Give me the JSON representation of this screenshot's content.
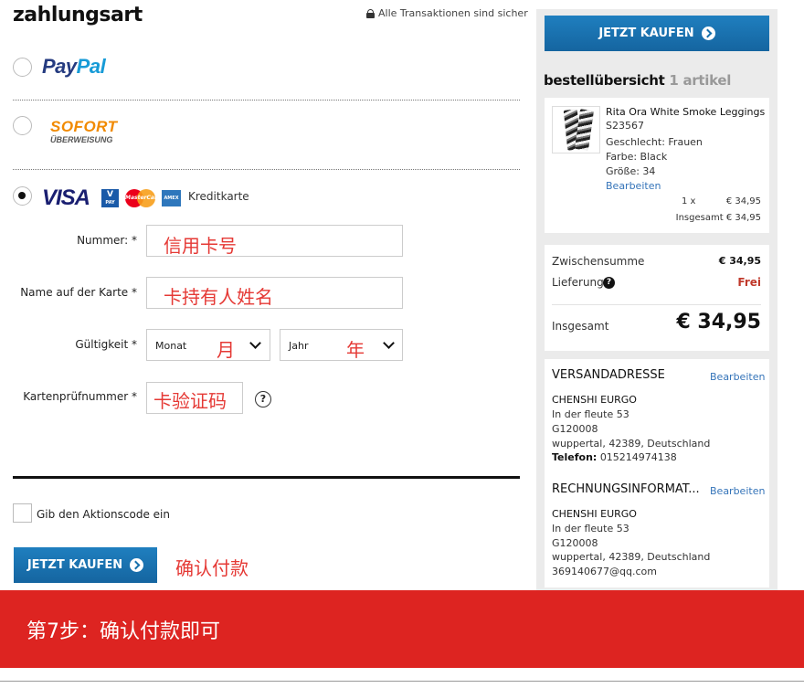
{
  "page": {
    "title": "zahlungsart",
    "secure_text": "Alle Transaktionen sind sicher"
  },
  "payment_options": {
    "paypal": {
      "part1": "Pay",
      "part2": "Pal"
    },
    "sofort": {
      "line1": "SOFORT",
      "line2": "ÜBERWEISUNG"
    },
    "card": {
      "visa_label": "VISA",
      "vpay_label": "V",
      "vpay_sub": "PAY",
      "mastercard_label": "MasterCard",
      "amex_label": "AMEX",
      "label": "Kreditkarte"
    }
  },
  "form": {
    "number_label": "Nummer: *",
    "name_label": "Name auf der Karte *",
    "validity_label": "Gültigkeit *",
    "month_select": "Monat",
    "year_select": "Jahr",
    "cvc_label": "Kartenprüfnummer *",
    "cvc_help": "?"
  },
  "annotations": {
    "number": "信用卡号",
    "name": "卡持有人姓名",
    "month": "月",
    "year": "年",
    "cvc": "卡验证码",
    "confirm": "确认付款"
  },
  "promo": {
    "label": "Gib den Aktionscode ein"
  },
  "buttons": {
    "buy_now": "JETZT KAUFEN"
  },
  "order_summary": {
    "title": "bestellübersicht",
    "count": "1 artikel",
    "item": {
      "name": "Rita Ora White Smoke Leggings",
      "sku": "S23567",
      "gender": "Geschlecht: Frauen",
      "color": "Farbe: Black",
      "size": "Größe: 34",
      "edit": "Bearbeiten",
      "qty": "1 x",
      "price": "€ 34,95",
      "total_label": "Insgesamt € 34,95"
    },
    "subtotal_label": "Zwischensumme",
    "subtotal_value": "€ 34,95",
    "delivery_label": "Lieferung",
    "delivery_value": "Frei",
    "total_label": "Insgesamt",
    "total_value": "€ 34,95"
  },
  "shipping": {
    "title": "VERSANDADRESSE",
    "edit": "Bearbeiten",
    "name": "CHENSHI EURGO",
    "street": "In der fleute 53",
    "code": "G120008",
    "city": "wuppertal, 42389, Deutschland",
    "phone_label": "Telefon:",
    "phone": "015214974138"
  },
  "billing": {
    "title": "RECHNUNGSINFORMAT...",
    "edit": "Bearbeiten",
    "name": "CHENSHI EURGO",
    "street": "In der fleute 53",
    "code": "G120008",
    "city": "wuppertal, 42389, Deutschland",
    "email": "369140677@qq.com"
  },
  "banner": {
    "text": "第7步：确认付款即可"
  },
  "colors": {
    "accent_blue": "#1670ab",
    "banner_red": "#dd2421",
    "annotation_red": "#e53935",
    "free_red": "#c0392b"
  }
}
